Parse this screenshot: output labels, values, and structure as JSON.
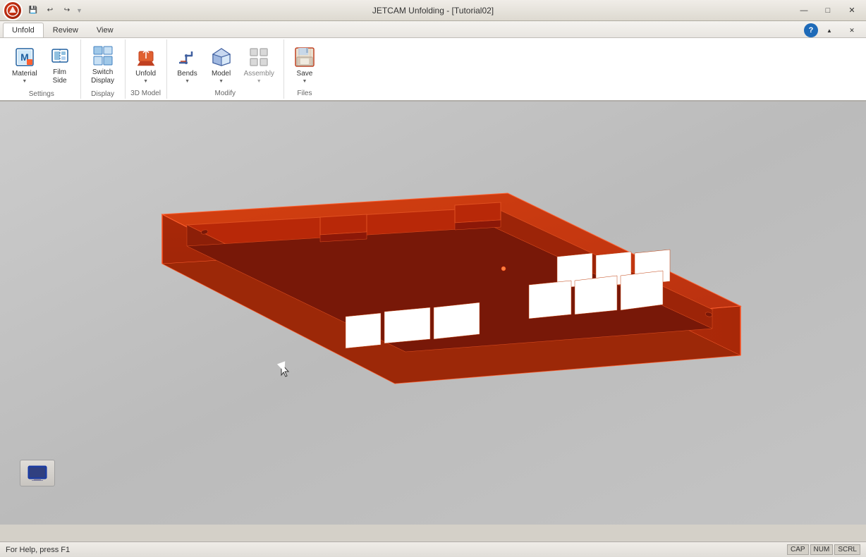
{
  "titleBar": {
    "title": "JETCAM Unfolding - [Tutorial02]",
    "quickAccess": [
      "save",
      "undo",
      "redo",
      "customize"
    ],
    "windowControls": [
      "minimize",
      "maximize",
      "close"
    ]
  },
  "ribbon": {
    "tabs": [
      {
        "id": "unfold",
        "label": "Unfold",
        "active": true
      },
      {
        "id": "review",
        "label": "Review",
        "active": false
      },
      {
        "id": "view",
        "label": "View",
        "active": false
      }
    ],
    "groups": [
      {
        "id": "settings",
        "label": "Settings",
        "buttons": [
          {
            "id": "material",
            "label": "Material",
            "hasDropdown": true
          },
          {
            "id": "film-side",
            "label": "Film Side",
            "hasDropdown": false
          }
        ]
      },
      {
        "id": "display",
        "label": "Display",
        "buttons": [
          {
            "id": "switch",
            "label": "Switch\nDisplay",
            "hasDropdown": false
          }
        ]
      },
      {
        "id": "3d-model",
        "label": "3D Model",
        "buttons": [
          {
            "id": "unfold",
            "label": "Unfold",
            "hasDropdown": true
          }
        ]
      },
      {
        "id": "modify",
        "label": "Modify",
        "buttons": [
          {
            "id": "bends",
            "label": "Bends",
            "hasDropdown": true
          },
          {
            "id": "model",
            "label": "Model",
            "hasDropdown": true
          },
          {
            "id": "assembly",
            "label": "Assembly",
            "hasDropdown": true
          }
        ]
      },
      {
        "id": "files",
        "label": "Files",
        "buttons": [
          {
            "id": "save",
            "label": "Save",
            "hasDropdown": true
          }
        ]
      }
    ]
  },
  "statusBar": {
    "helpText": "For Help, press F1",
    "indicators": [
      "CAP",
      "NUM",
      "SCRL"
    ]
  },
  "canvas": {
    "backgroundColor": "#c8c5c0",
    "modelColor": "#c84010"
  }
}
